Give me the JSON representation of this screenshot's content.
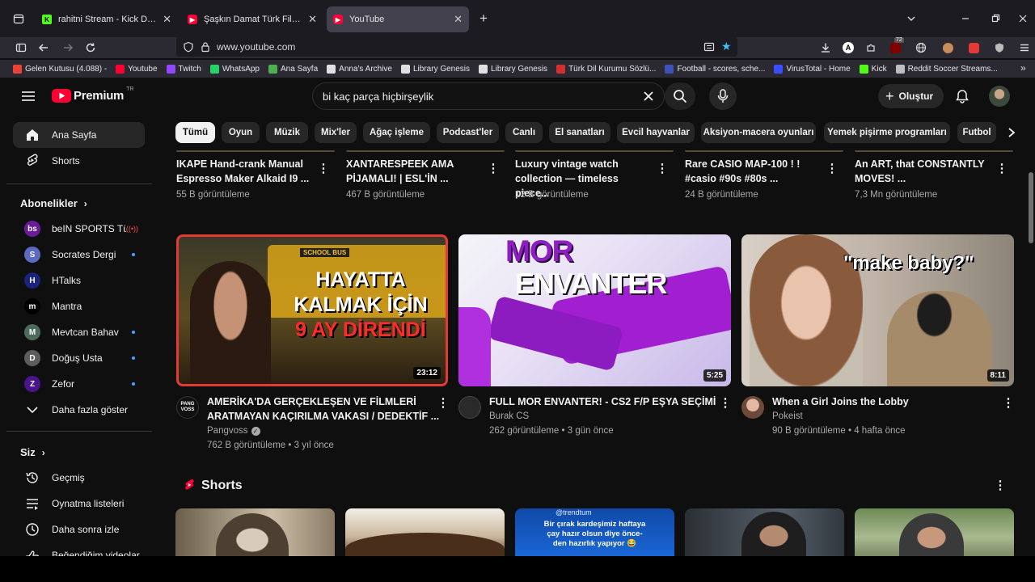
{
  "browser": {
    "tabs": [
      {
        "label": "rahitni Stream - Kick Dashboard",
        "color": "#53fc18",
        "glyph": "K"
      },
      {
        "label": "Şaşkın Damat Türk Filmi | FULL",
        "color": "#ff0033",
        "glyph": "▶"
      },
      {
        "label": "YouTube",
        "color": "#ff0033",
        "glyph": "▶"
      }
    ],
    "new_tab_label": "+",
    "url": "www.youtube.com",
    "extension_badge": "72",
    "bookmarks": [
      {
        "label": "Gelen Kutusu (4.088) -",
        "color": "#ea4335"
      },
      {
        "label": "Youtube",
        "color": "#ff0033"
      },
      {
        "label": "Twitch",
        "color": "#9146ff"
      },
      {
        "label": "WhatsApp",
        "color": "#25d366"
      },
      {
        "label": "Ana Sayfa",
        "color": "#4caf50"
      },
      {
        "label": "Anna's Archive",
        "color": "#e0e0e0"
      },
      {
        "label": "Library Genesis",
        "color": "#e0e0e0"
      },
      {
        "label": "Library Genesis",
        "color": "#e0e0e0"
      },
      {
        "label": "Türk Dil Kurumu Sözlü...",
        "color": "#d32f2f"
      },
      {
        "label": "Football - scores, sche...",
        "color": "#3f51b5"
      },
      {
        "label": "VirusTotal - Home",
        "color": "#394eff"
      },
      {
        "label": "Kick",
        "color": "#53fc18"
      },
      {
        "label": "Reddit Soccer Streams...",
        "color": "#bdbdbd"
      }
    ]
  },
  "header": {
    "logo_text": "Premium",
    "logo_region": "TR",
    "search_value": "bi kaç parça hiçbirşeylik",
    "create_label": "Oluştur"
  },
  "chips": [
    "Tümü",
    "Oyun",
    "Müzik",
    "Mix'ler",
    "Ağaç işleme",
    "Podcast'ler",
    "Canlı",
    "El sanatları",
    "Evcil hayvanlar",
    "Aksiyon-macera oyunları",
    "Yemek pişirme programları",
    "Futbol"
  ],
  "sidebar": {
    "main": [
      {
        "label": "Ana Sayfa",
        "icon": "home-icon"
      },
      {
        "label": "Shorts",
        "icon": "shorts-icon"
      }
    ],
    "subs_title": "Abonelikler",
    "subscriptions": [
      {
        "label": "beIN SPORTS Tü...",
        "color": "#6a1b9a",
        "glyph": "bs",
        "state": "live"
      },
      {
        "label": "Socrates Dergi",
        "color": "#5c6bc0",
        "glyph": "S",
        "state": "dot"
      },
      {
        "label": "HTalks",
        "color": "#1a237e",
        "glyph": "H",
        "state": ""
      },
      {
        "label": "Mantra",
        "color": "#000000",
        "glyph": "m",
        "state": ""
      },
      {
        "label": "Mevtcan Bahav",
        "color": "#4e6b5a",
        "glyph": "M",
        "state": "dot"
      },
      {
        "label": "Doğuş Usta",
        "color": "#5d5d5d",
        "glyph": "D",
        "state": "dot"
      },
      {
        "label": "Zefor",
        "color": "#4a148c",
        "glyph": "Z",
        "state": "dot"
      }
    ],
    "show_more": "Daha fazla göster",
    "you_title": "Siz",
    "you_items": [
      {
        "label": "Geçmiş",
        "icon": "history-icon"
      },
      {
        "label": "Oynatma listeleri",
        "icon": "playlist-icon"
      },
      {
        "label": "Daha sonra izle",
        "icon": "clock-icon"
      },
      {
        "label": "Beğendiğim videolar",
        "icon": "like-icon"
      }
    ]
  },
  "top_row": [
    {
      "line1": "IKAPE Hand-crank Manual",
      "line2": "Espresso Maker Alkaid I9 ...",
      "meta": "55 B görüntüleme"
    },
    {
      "line1": "XANTARESPEEK AMA",
      "line2": "PİJAMALI! | ESL'İN ...",
      "meta": "467 B görüntüleme"
    },
    {
      "line1": "Luxury vintage watch",
      "line2": "collection — timeless piece...",
      "meta": "12 B görüntüleme"
    },
    {
      "line1": "Rare CASIO MAP-100 ! !",
      "line2": "#casio #90s #80s ...",
      "meta": "24 B görüntüleme"
    },
    {
      "line1": "An ART, that CONSTANTLY",
      "line2": "MOVES! ...",
      "meta": "7,3 Mn görüntüleme"
    }
  ],
  "videos": [
    {
      "thumb_text_1": "HAYATTA",
      "thumb_text_2": "KALMAK İÇİN",
      "thumb_text_3": "9 AY DİRENDİ",
      "thumb_sign": "SCHOOL BUS",
      "duration": "23:12",
      "title_1": "AMERİKA'DA GERÇEKLEŞEN VE FİLMLERİ",
      "title_2": "ARATMAYAN KAÇIRILMA VAKASI / DEDEKTİF ...",
      "channel": "Pangvoss",
      "channel_badge": "PANG VOSS",
      "views": "762 B görüntüleme",
      "age": "3 yıl önce"
    },
    {
      "thumb_text_1": "MOR",
      "thumb_text_2": "ENVANTER",
      "duration": "5:25",
      "title_1": "FULL MOR ENVANTER! - CS2 F/P EŞYA SEÇİMİ",
      "channel": "Burak CS",
      "views": "262 görüntüleme",
      "age": "3 gün önce"
    },
    {
      "thumb_text_1": "\"make baby?\"",
      "duration": "8:11",
      "title_1": "When a Girl Joins the Lobby",
      "channel": "Pokeist",
      "views": "90 B görüntüleme",
      "age": "4 hafta önce"
    }
  ],
  "shorts": {
    "title": "Shorts",
    "third_handle": "@trendtum",
    "third_caption_1": "Bir çırak kardeşimiz haftaya",
    "third_caption_2": "çay hazır olsun diye önce-",
    "third_caption_3": "den hazırlık yapıyor 😂"
  }
}
